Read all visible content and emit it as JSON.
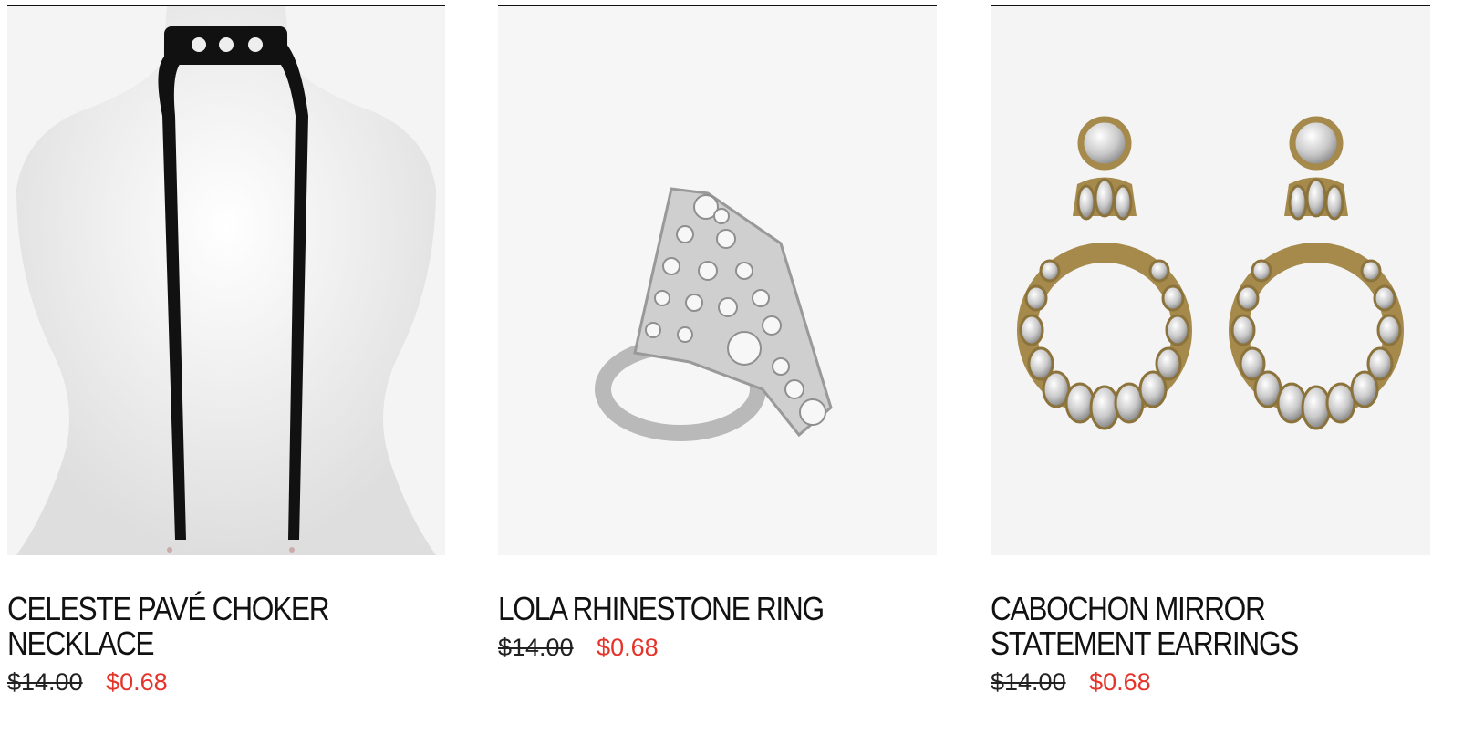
{
  "products": [
    {
      "name": "CELESTE PAVÉ CHOKER NECKLACE",
      "name_lines": [
        "CELESTE PAVÉ CHOKER",
        "NECKLACE"
      ],
      "original_price": "$14.00",
      "sale_price": "$0.68",
      "image_icon": "choker-necklace-image"
    },
    {
      "name": "LOLA RHINESTONE RING",
      "name_lines": [
        "LOLA RHINESTONE RING"
      ],
      "original_price": "$14.00",
      "sale_price": "$0.68",
      "image_icon": "rhinestone-ring-image"
    },
    {
      "name": "CABOCHON MIRROR STATEMENT EARRINGS",
      "name_lines": [
        "CABOCHON MIRROR",
        "STATEMENT EARRINGS"
      ],
      "original_price": "$14.00",
      "sale_price": "$0.68",
      "image_icon": "statement-earrings-image"
    }
  ],
  "colors": {
    "sale_price": "#e53329",
    "text": "#111111",
    "image_bg": "#f5f5f5"
  }
}
